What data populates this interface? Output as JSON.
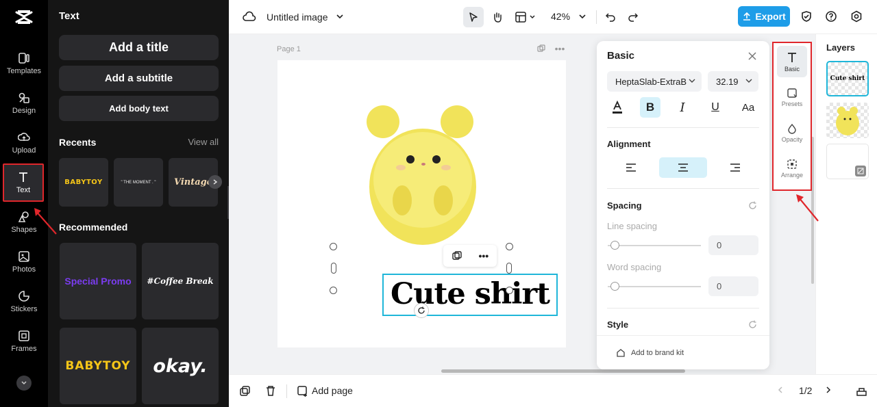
{
  "app": {
    "name": "CapCut"
  },
  "rail": {
    "items": [
      {
        "label": "Templates",
        "icon": "templates-icon"
      },
      {
        "label": "Design",
        "icon": "design-icon"
      },
      {
        "label": "Upload",
        "icon": "upload-icon"
      },
      {
        "label": "Text",
        "icon": "text-icon",
        "active": true
      },
      {
        "label": "Shapes",
        "icon": "shapes-icon"
      },
      {
        "label": "Photos",
        "icon": "photos-icon"
      },
      {
        "label": "Stickers",
        "icon": "stickers-icon"
      },
      {
        "label": "Frames",
        "icon": "frames-icon"
      }
    ]
  },
  "text_panel": {
    "title": "Text",
    "add_title": "Add a title",
    "add_subtitle": "Add a subtitle",
    "add_body": "Add body text",
    "recents_label": "Recents",
    "view_all": "View all",
    "recents": [
      "BABYTOY",
      "\" THE MOMENT . \"",
      "Vintage"
    ],
    "recommended_label": "Recommended",
    "recommended": [
      "Special Promo",
      "#Coffee Break",
      "BABYTOY",
      "okay."
    ]
  },
  "topbar": {
    "file_name": "Untitled image",
    "zoom": "42%",
    "export_label": "Export"
  },
  "canvas": {
    "page_label": "Page 1",
    "text_content": "Cute shirt"
  },
  "basic_panel": {
    "title": "Basic",
    "font": "HeptaSlab-ExtraB",
    "font_size": "32.19",
    "alignment_label": "Alignment",
    "spacing_label": "Spacing",
    "line_spacing_label": "Line spacing",
    "line_spacing_value": "0",
    "word_spacing_label": "Word spacing",
    "word_spacing_value": "0",
    "style_label": "Style",
    "brand_kit_label": "Add to brand kit"
  },
  "tools": {
    "items": [
      "Basic",
      "Presets",
      "Opacity",
      "Arrange"
    ]
  },
  "layers": {
    "title": "Layers",
    "items": [
      "Cute shirt"
    ]
  },
  "bottombar": {
    "add_page": "Add page",
    "page_indicator": "1/2"
  },
  "colors": {
    "accent": "#1e9de8",
    "highlight": "#e0262b",
    "selection": "#1fb6d9"
  }
}
